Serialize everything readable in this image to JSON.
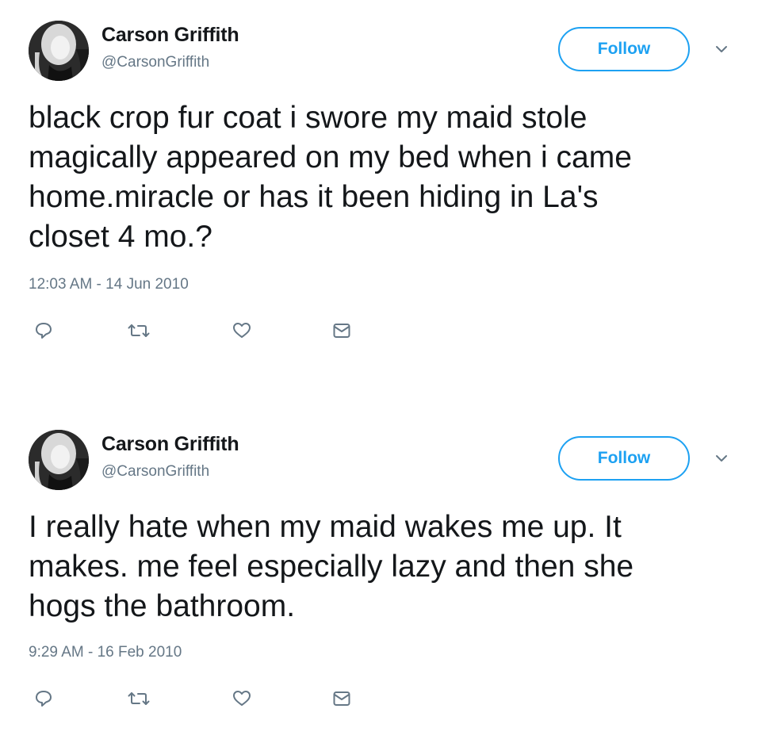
{
  "tweets": [
    {
      "author": {
        "name": "Carson Griffith",
        "handle": "@CarsonGriffith"
      },
      "follow_label": "Follow",
      "text": "black crop fur coat i swore my maid stole\nmagically appeared on my bed when i came\nhome.miracle or has it been hiding in La's\ncloset 4 mo.?",
      "timestamp": "12:03 AM - 14 Jun 2010",
      "actions": [
        "reply-icon",
        "retweet-icon",
        "like-icon",
        "direct-message-icon"
      ]
    },
    {
      "author": {
        "name": "Carson Griffith",
        "handle": "@CarsonGriffith"
      },
      "follow_label": "Follow",
      "text": "I really hate when my maid wakes me up. It\nmakes. me feel especially lazy and then she\nhogs the bathroom.",
      "timestamp": "9:29 AM - 16 Feb 2010",
      "actions": [
        "reply-icon",
        "retweet-icon",
        "like-icon",
        "direct-message-icon"
      ]
    }
  ],
  "colors": {
    "accent": "#1da1f2",
    "text": "#14171a",
    "muted": "#657786"
  }
}
